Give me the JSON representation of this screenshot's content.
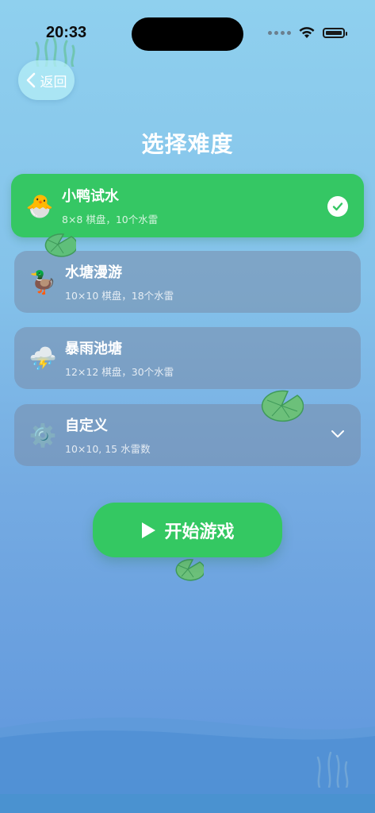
{
  "status_bar": {
    "time": "20:33"
  },
  "nav": {
    "back_label": "返回"
  },
  "page": {
    "title": "选择难度"
  },
  "difficulties": [
    {
      "name": "小鸭试水",
      "desc": "8×8 棋盘，10个水雷",
      "icon": "hatching-chick-icon",
      "emoji": "🐣",
      "selected": true
    },
    {
      "name": "水塘漫游",
      "desc": "10×10 棋盘，18个水雷",
      "icon": "duck-icon",
      "emoji": "🦆",
      "selected": false
    },
    {
      "name": "暴雨池塘",
      "desc": "12×12 棋盘，30个水雷",
      "icon": "storm-cloud-icon",
      "emoji": "⛈️",
      "selected": false
    },
    {
      "name": "自定义",
      "desc": "10×10, 15 水雷数",
      "icon": "gear-icon",
      "emoji": "⚙️",
      "selected": false
    }
  ],
  "start_button": {
    "label": "开始游戏"
  },
  "colors": {
    "selected_card": "#35c764",
    "card": "#788caa",
    "start_button": "#34c862"
  }
}
